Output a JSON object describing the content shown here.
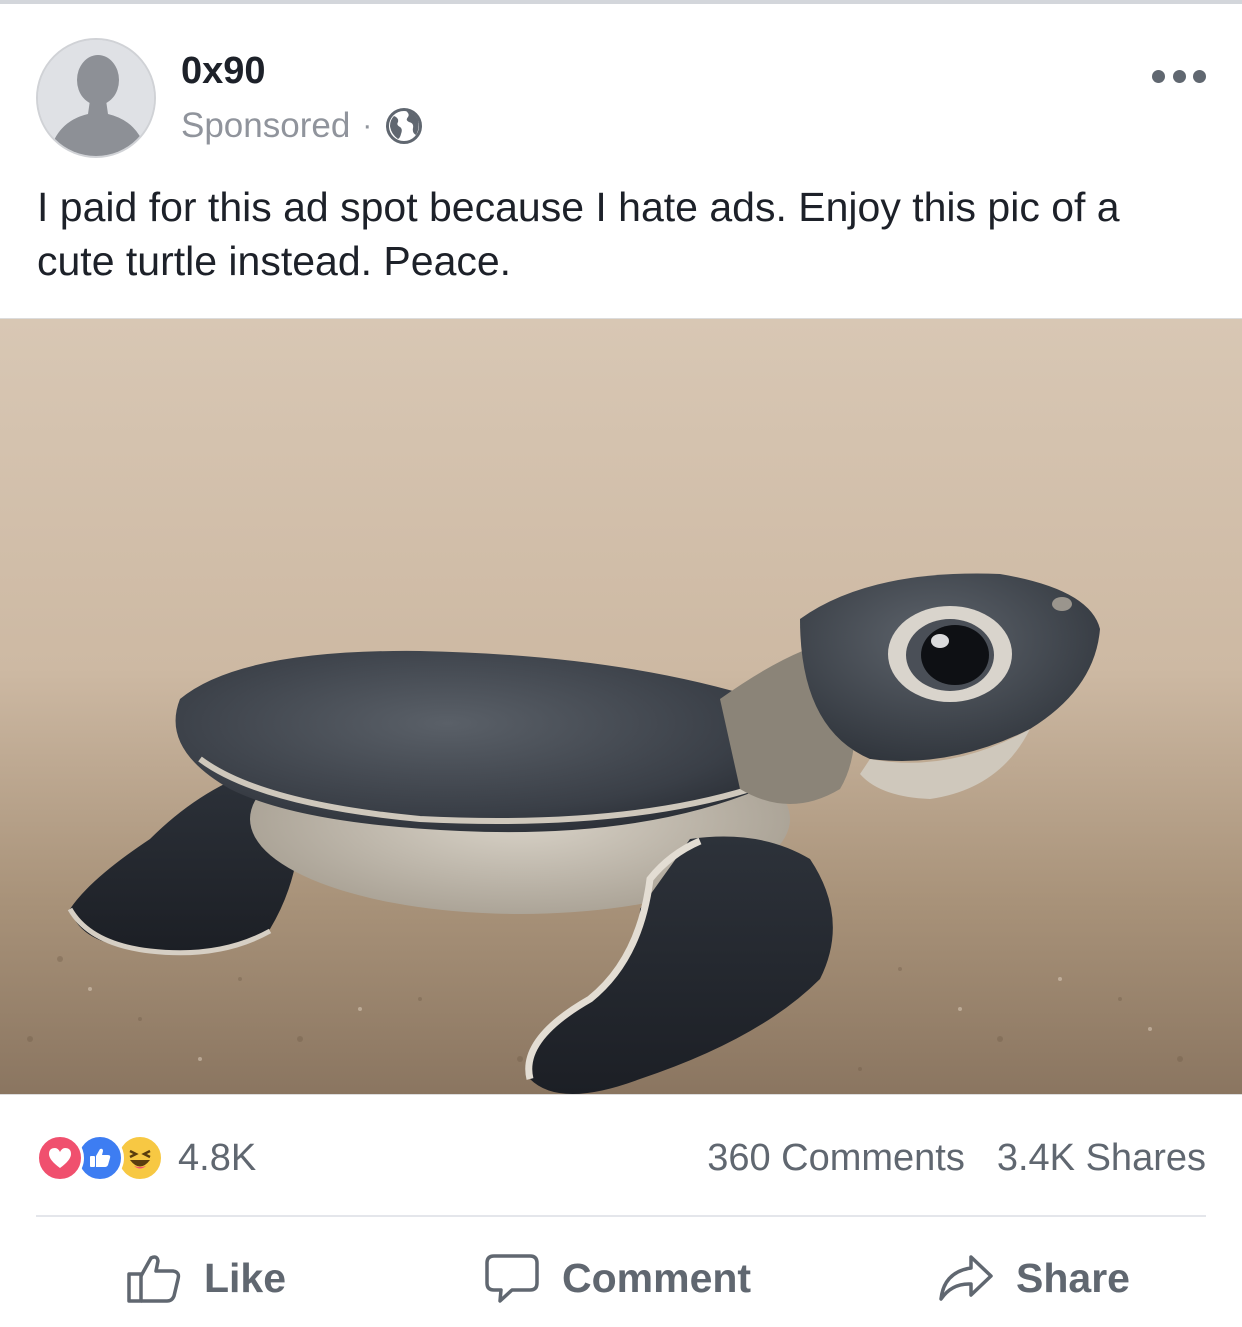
{
  "post": {
    "author": "0x90",
    "sponsored_label": "Sponsored",
    "meta_separator": "·",
    "audience_icon": "globe-icon",
    "menu_icon": "more-options-icon",
    "caption": "I paid for this ad spot because I hate ads. Enjoy this pic of a cute turtle instead. Peace."
  },
  "photo": {
    "subject": "baby sea turtle on sand"
  },
  "stats": {
    "reaction_icons": [
      "love-reaction-icon",
      "like-reaction-icon",
      "haha-reaction-icon"
    ],
    "reaction_count": "4.8K",
    "comments": "360 Comments",
    "shares": "3.4K Shares"
  },
  "actions": {
    "like_label": "Like",
    "comment_label": "Comment",
    "share_label": "Share"
  },
  "colors": {
    "text_primary": "#1d2129",
    "text_secondary": "#606770",
    "love": "#f0506e",
    "like": "#3d7df2",
    "haha": "#f7c843"
  }
}
